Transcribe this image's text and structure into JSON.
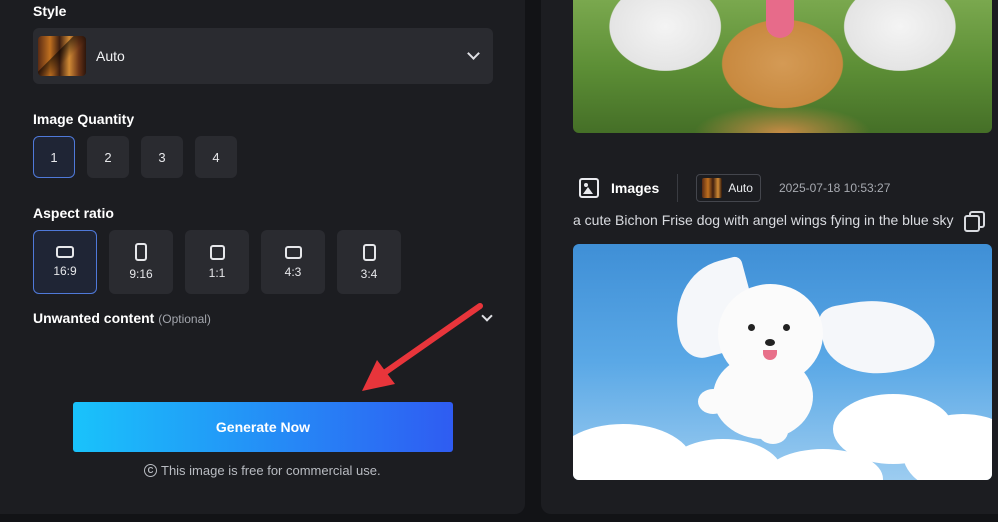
{
  "left": {
    "style": {
      "label": "Style",
      "value": "Auto",
      "thumb_icon": "style-thumbnail"
    },
    "quantity": {
      "label": "Image Quantity",
      "options": [
        "1",
        "2",
        "3",
        "4"
      ],
      "selected": "1"
    },
    "aspect_ratio": {
      "label": "Aspect ratio",
      "options": [
        "16:9",
        "9:16",
        "1:1",
        "4:3",
        "3:4"
      ],
      "selected": "16:9"
    },
    "unwanted": {
      "label": "Unwanted content",
      "optional": "(Optional)"
    },
    "generate_label": "Generate Now",
    "free_note": "This image is free for commercial use.",
    "copyright_symbol": "C"
  },
  "right": {
    "result": {
      "type_label": "Images",
      "style_tag": "Auto",
      "timestamp": "2025-07-18 10:53:27",
      "prompt": "a cute Bichon Frise dog with angel wings fying in the blue sky"
    }
  },
  "colors": {
    "panel_bg": "#1c1d21",
    "page_bg": "#121316",
    "accent_border": "#4f79d9",
    "generate_gradient_start": "#19c3fb",
    "generate_gradient_end": "#2f5cf2",
    "annotation_arrow": "#e8353b"
  }
}
